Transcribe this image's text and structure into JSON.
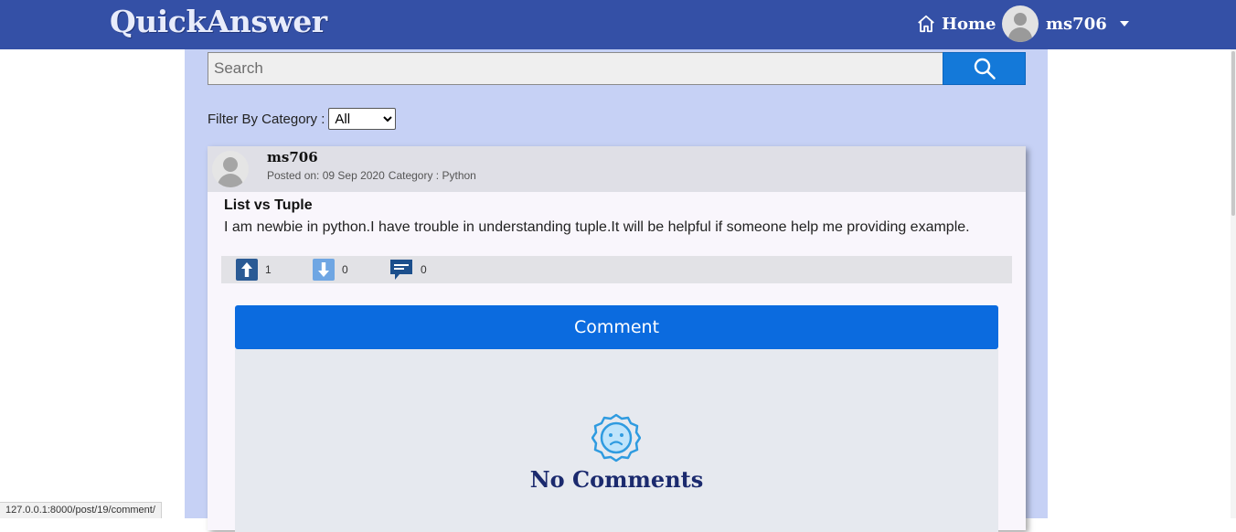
{
  "navbar": {
    "brand": "QuickAnswer",
    "home_label": "Home",
    "username": "ms706"
  },
  "search": {
    "placeholder": "Search",
    "value": ""
  },
  "filter": {
    "label": "Filter By Category :",
    "selected": "All"
  },
  "post": {
    "author": "ms706",
    "posted_label": "Posted on: 09 Sep 2020",
    "category_label": "Category : Python",
    "title": "List vs Tuple",
    "body": "I am newbie in python.I have trouble in understanding tuple.It will be helpful if someone help me providing example.",
    "upvotes": "1",
    "downvotes": "0",
    "comments": "0"
  },
  "comment_section": {
    "button_label": "Comment",
    "empty_text": "No Comments"
  },
  "status_bar": {
    "url": "127.0.0.1:8000/post/19/comment/"
  },
  "colors": {
    "navbar": "#3450a6",
    "content_bg": "#c6d1f5",
    "primary_button": "#0b6bdf",
    "search_button": "#1479d9"
  },
  "icons": [
    "home-icon",
    "search-icon",
    "upvote-icon",
    "downvote-icon",
    "comment-icon",
    "sad-face-icon",
    "avatar"
  ]
}
